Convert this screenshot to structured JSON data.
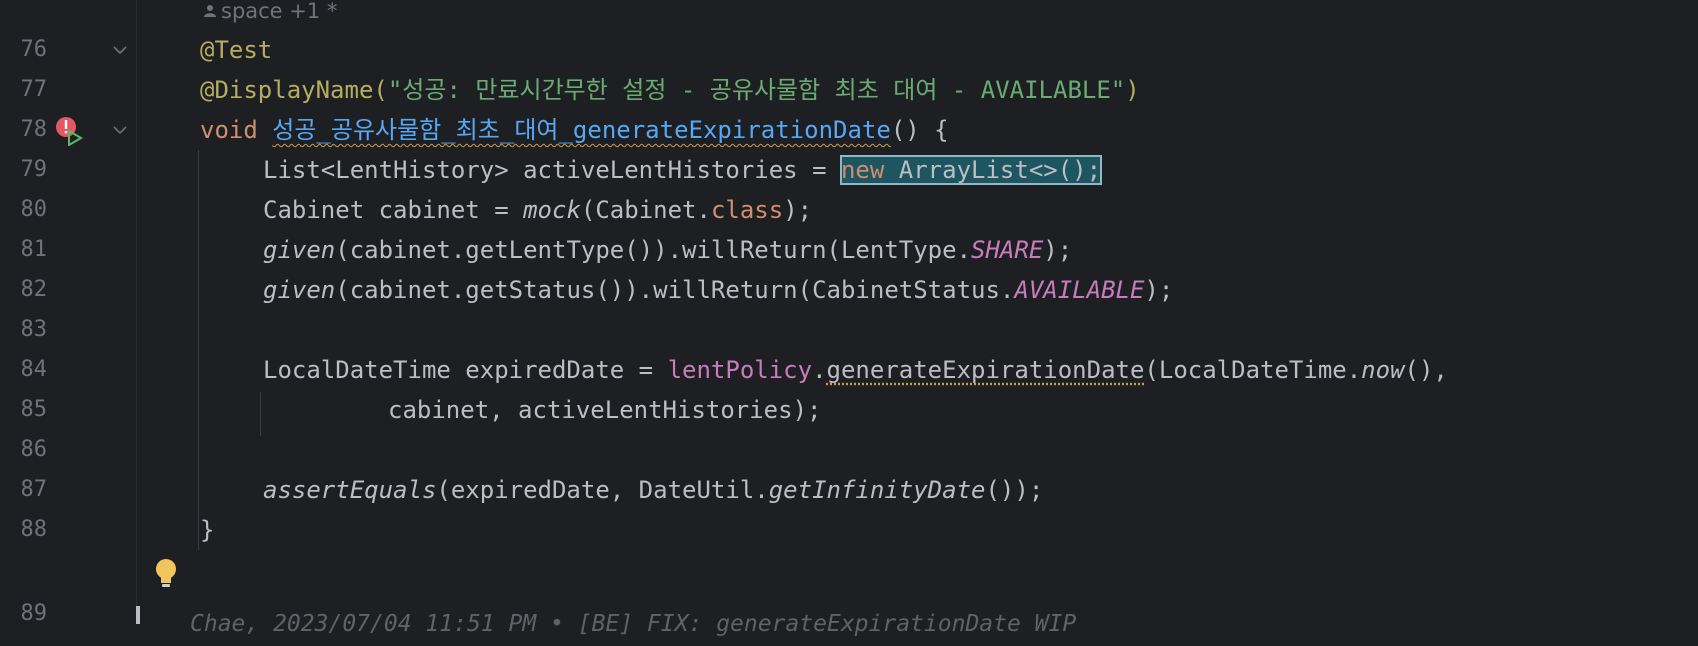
{
  "author_hint": {
    "text": "space +1 *"
  },
  "lines": [
    {
      "num": "76"
    },
    {
      "num": "77"
    },
    {
      "num": "78"
    },
    {
      "num": "79"
    },
    {
      "num": "80"
    },
    {
      "num": "81"
    },
    {
      "num": "82"
    },
    {
      "num": "83"
    },
    {
      "num": "84"
    },
    {
      "num": "85"
    },
    {
      "num": "86"
    },
    {
      "num": "87"
    },
    {
      "num": "88"
    },
    {
      "num": "89"
    }
  ],
  "code": {
    "l76": {
      "annotation": "@Test"
    },
    "l77": {
      "annotation": "@DisplayName(",
      "string": "\"성공: 만료시간무한 설정 - 공유사물함 최초 대여 - AVAILABLE\"",
      "close": ")"
    },
    "l78": {
      "keyword": "void",
      "method": "성공_공유사물함_최초_대여_generateExpirationDate",
      "rest": "() {"
    },
    "l79": {
      "decl": "List<LentHistory> activeLentHistories = ",
      "sel_kw": "new",
      "sel_rest": " ArrayList<>();"
    },
    "l80": {
      "decl": "Cabinet cabinet = ",
      "call": "mock",
      "arg": "(Cabinet.",
      "kw": "class",
      "end": ");"
    },
    "l81": {
      "call": "given",
      "mid": "(cabinet.getLentType()).willReturn(LentType.",
      "const": "SHARE",
      "end": ");"
    },
    "l82": {
      "call": "given",
      "mid": "(cabinet.getStatus()).willReturn(CabinetStatus.",
      "const": "AVAILABLE",
      "end": ");"
    },
    "l84": {
      "decl": "LocalDateTime expiredDate = ",
      "field": "lentPolicy",
      "dot": ".",
      "method": "generateExpirationDate",
      "arg": "(LocalDateTime.",
      "static_call": "now",
      "end": "(),"
    },
    "l85": {
      "text": "cabinet, activeLentHistories);"
    },
    "l87": {
      "call": "assertEquals",
      "mid": "(expiredDate, DateUtil.",
      "static_call": "getInfinityDate",
      "end": "());"
    },
    "l88": {
      "text": "}"
    }
  },
  "blame": {
    "text": "Chae, 2023/07/04 11:51 PM • [BE] FIX: generateExpirationDate WIP"
  }
}
